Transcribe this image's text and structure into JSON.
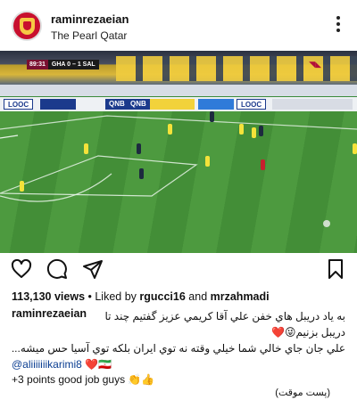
{
  "header": {
    "username": "raminrezaeian",
    "location": "The Pearl Qatar"
  },
  "media": {
    "scorebug_time": "89:31",
    "scorebug_teams": "GHA  0 – 1  SAL",
    "ads": [
      "QNB",
      "QNB",
      "QNB",
      "LOOC",
      "LOOC"
    ]
  },
  "engagement": {
    "views_count": "113,130 views",
    "liked_by_prefix": " • Liked by ",
    "liked_user_1": "rgucci16",
    "liked_and": " and ",
    "liked_user_2": "mrzahmadi"
  },
  "caption": {
    "username": "raminrezaeian",
    "line_1": "به یاد دریبل هاي خفن علي آقا كريمي عزيز گفتيم چند تا",
    "line_2": "دريبل بزنيم😜❤️",
    "line_3": "علي جان جاي خالي شما خيلي وقته نه توي ايران بلكه توي آسيا حس ميشه...",
    "mention": "@aliiiiiiikarimi8",
    "mention_emoji": " ❤️🇮🇷",
    "line_5": "+3 points good job guys 👏👍"
  },
  "timestamp": "(پست موقت)"
}
